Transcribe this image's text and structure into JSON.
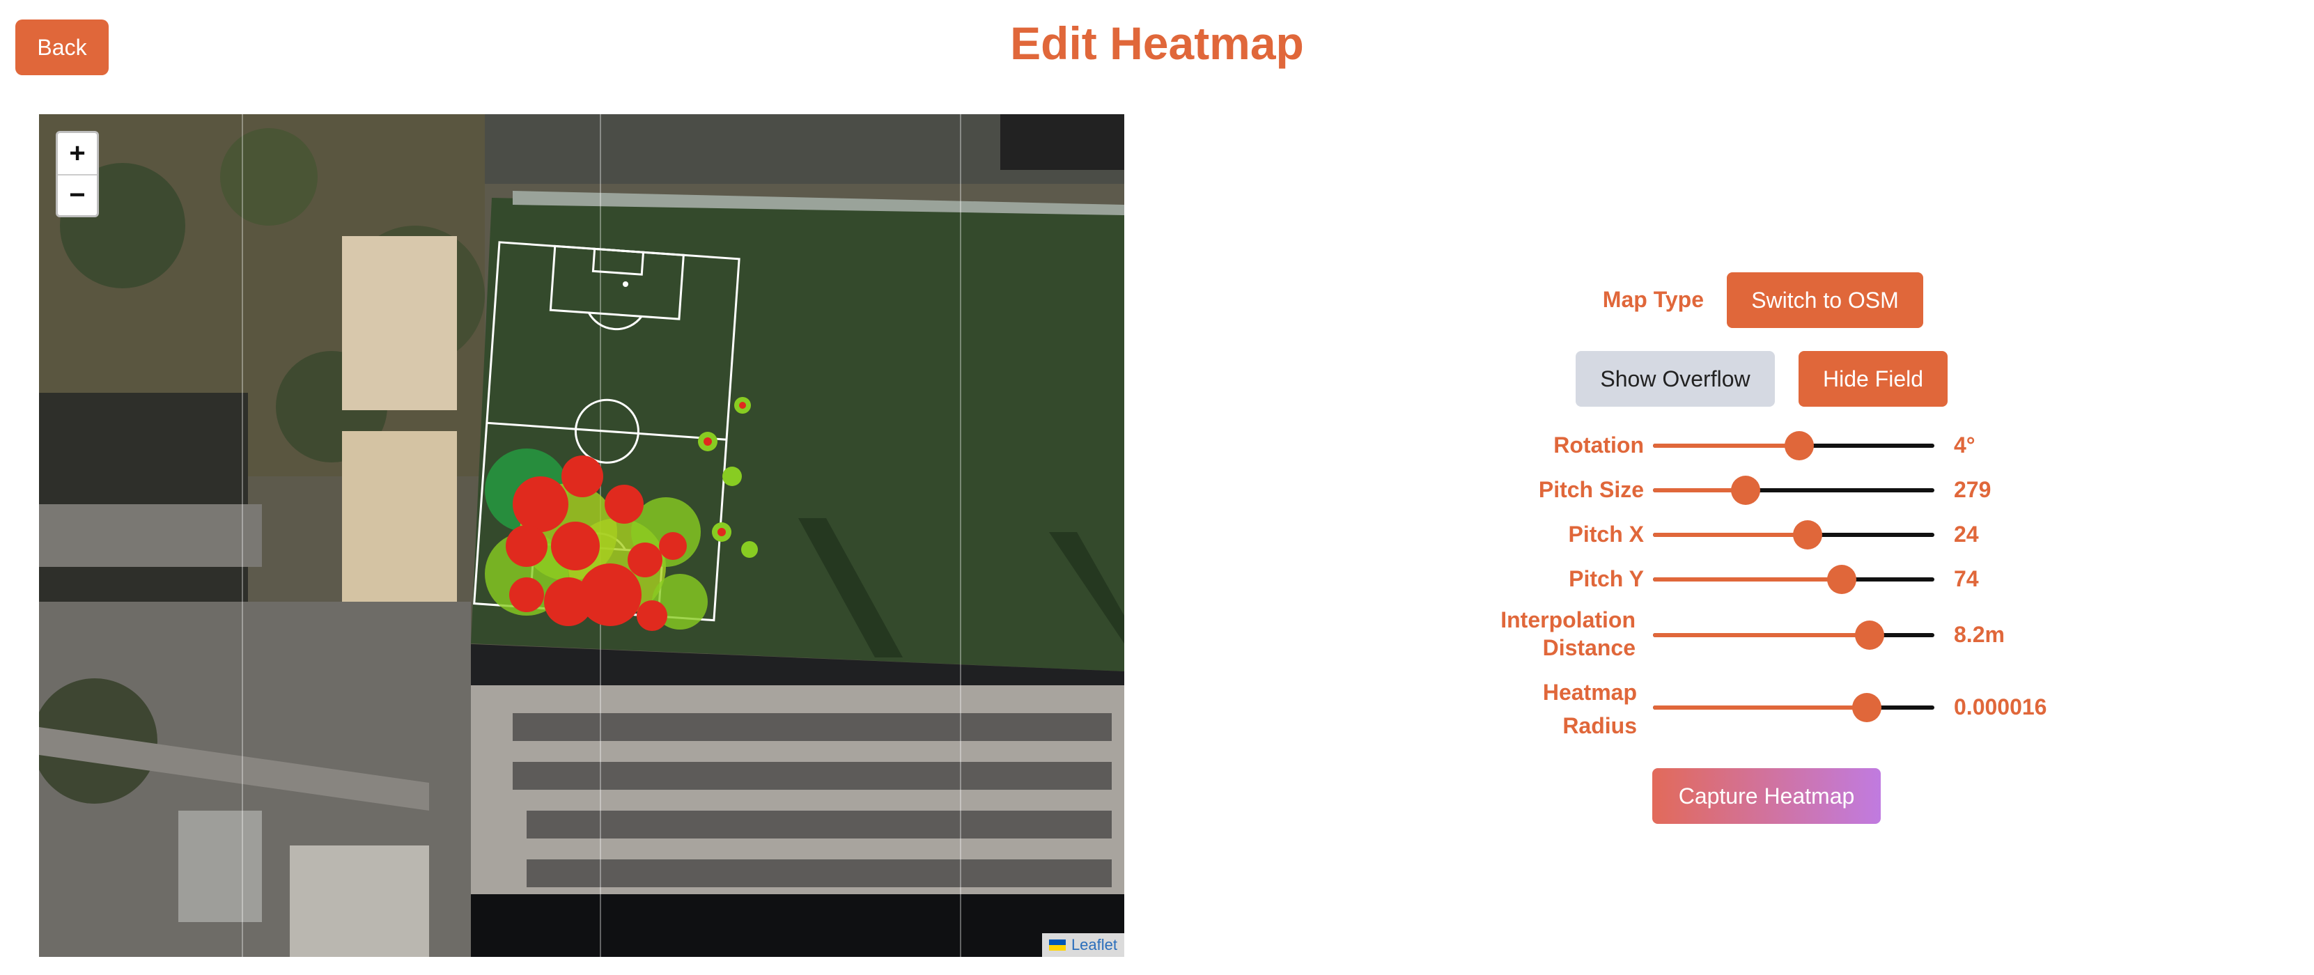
{
  "header": {
    "back_label": "Back",
    "title": "Edit Heatmap"
  },
  "map": {
    "zoom_in": "+",
    "zoom_out": "−",
    "attribution": "Leaflet"
  },
  "controls": {
    "map_type_label": "Map Type",
    "switch_button": "Switch to OSM",
    "overflow_button": "Show Overflow",
    "field_button": "Hide Field",
    "sliders": [
      {
        "label": "Rotation",
        "value": "4°",
        "level": 0.52
      },
      {
        "label": "Pitch Size",
        "value": "279",
        "level": 0.33
      },
      {
        "label": "Pitch X",
        "value": "24",
        "level": 0.55
      },
      {
        "label": "Pitch Y",
        "value": "74",
        "level": 0.67
      },
      {
        "label": "Interpolation Distance",
        "value": "8.2m",
        "level": 0.77
      },
      {
        "label": "Heatmap Radius",
        "value": "0.000016",
        "level": 0.76
      }
    ],
    "capture_button": "Capture Heatmap"
  },
  "colors": {
    "accent": "#e0673a",
    "gray_button": "#d5d9e2"
  }
}
